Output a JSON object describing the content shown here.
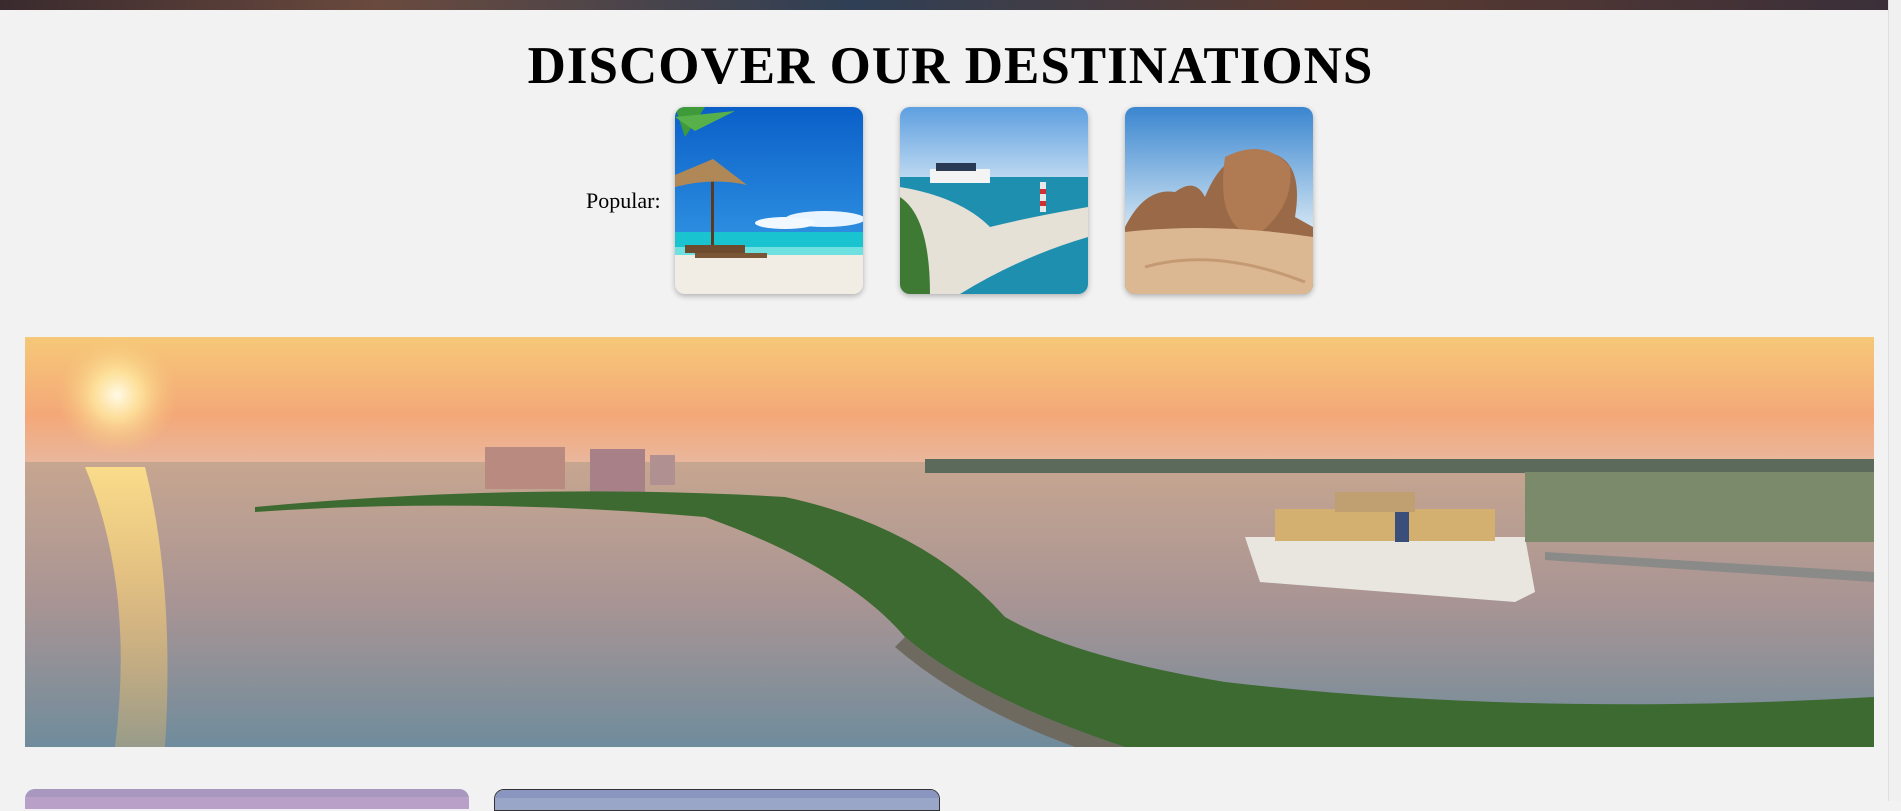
{
  "section": {
    "title": "DISCOVER OUR DESTINATIONS",
    "popular_label": "Popular:"
  },
  "popular_destinations": [
    {
      "image": "beach-umbrella-loungers-photo"
    },
    {
      "image": "island-lighthouse-cruise-ship-photo"
    },
    {
      "image": "desert-rock-formations-photo"
    }
  ],
  "hero": {
    "image": "sunset-cruise-ship-harbor-panorama-photo"
  },
  "cards": [
    {
      "image": "purple-sky-card-photo"
    },
    {
      "image": "blue-sky-card-photo"
    }
  ]
}
